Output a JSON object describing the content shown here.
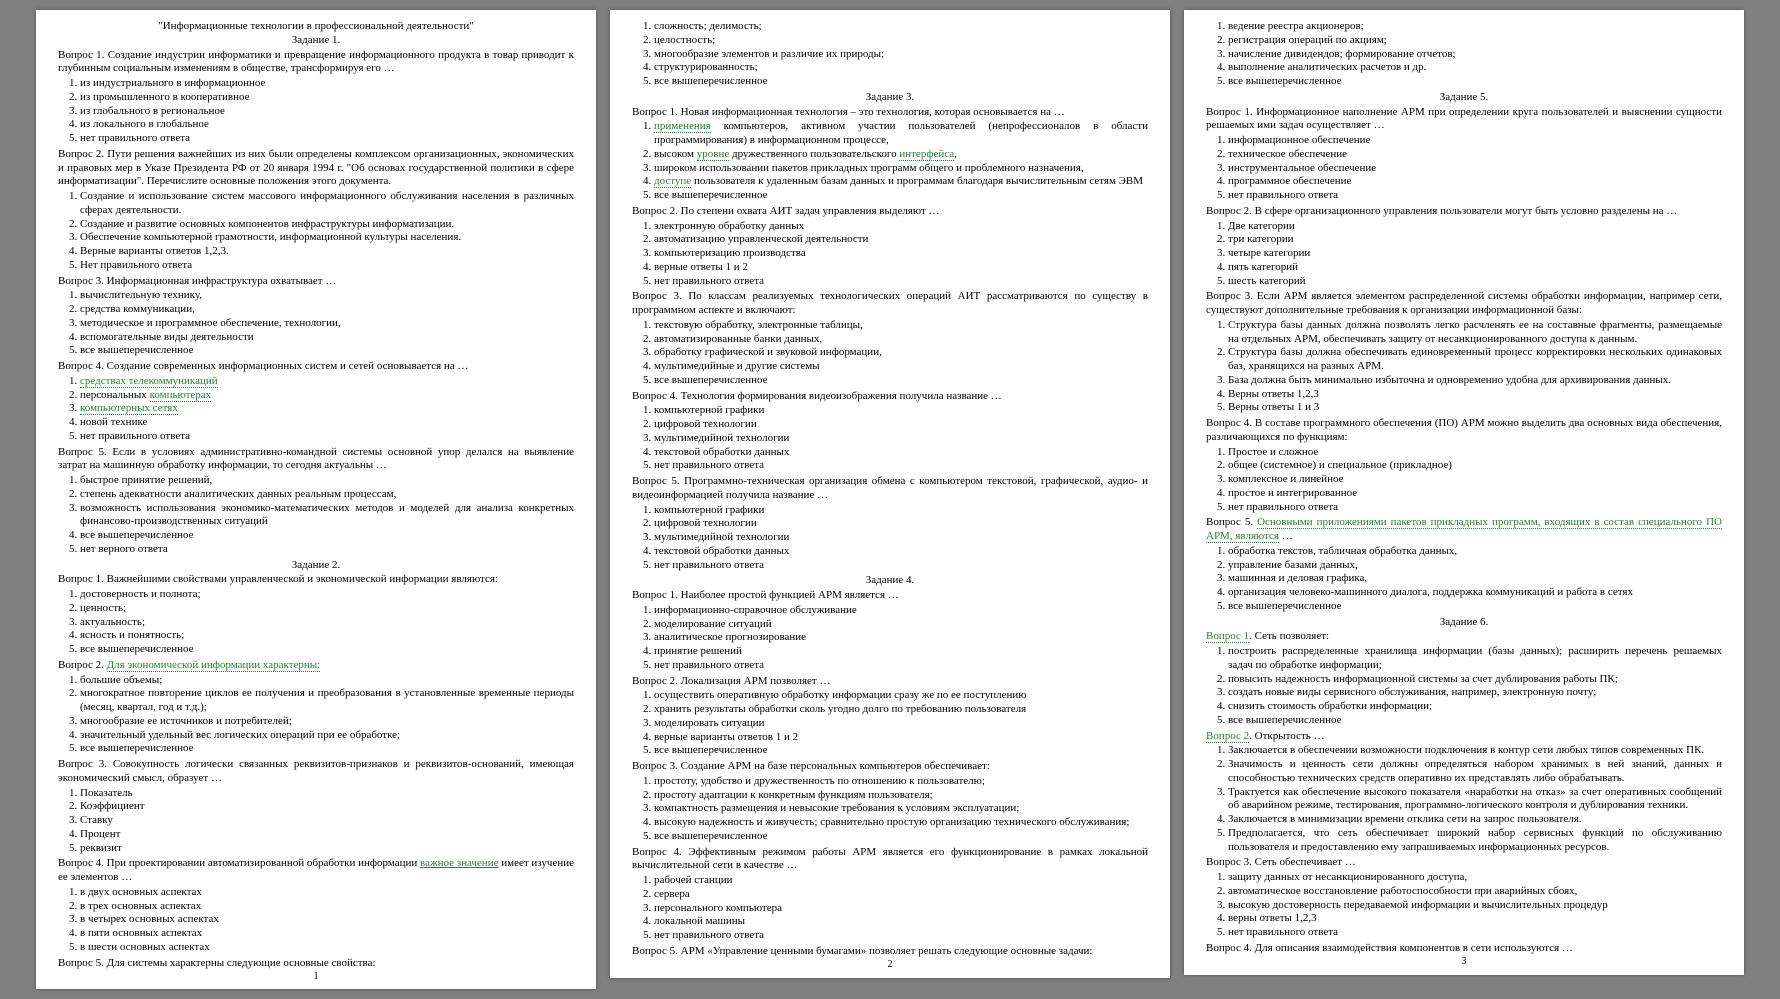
{
  "pages": [
    {
      "pagenum": "1",
      "blocks": [
        {
          "type": "title",
          "text": "\"Информационные технологии в профессиональной деятельности\""
        },
        {
          "type": "title",
          "text": "Задание 1."
        },
        {
          "type": "para",
          "text": "Вопрос 1. Создание индустрии информатики и превращение информационного продукта в товар приводит к глубинным социальным изменениям в обществе, трансформируя его …"
        },
        {
          "type": "list",
          "items": [
            "из индустриального в информационное",
            "из промышленного в кооперативное",
            "из глобального в региональное",
            "из локального в глобальное",
            "нет правильного ответа"
          ]
        },
        {
          "type": "para",
          "text": "Вопрос 2.  Пути решения важнейших из них были определены комплексом организационных, экономических и правовых мер в Указе Президента РФ от 20 января 1994 г. \"Об основах государственной политики в сфере информатизации\". Перечислите основные положения этого документа."
        },
        {
          "type": "list",
          "items": [
            "Создание и использование систем массового информационного обслуживания населения в различных сферах деятельности.",
            "Создание и развитие основных компонентов инфраструктуры   информатизации.",
            "Обеспечение компьютерной грамотности, информационной   культуры населения.",
            "Верные варианты ответов 1,2,3.",
            "Нет правильного ответа"
          ]
        },
        {
          "type": "para",
          "text": "Вопрос 3. Информационная инфраструктура охватывает …"
        },
        {
          "type": "list",
          "items": [
            "вычислительную технику,",
            "средства коммуникации,",
            "методическое и программное обеспечение,  технологии,",
            "вспомогательные виды деятельности",
            "все вышеперечисленное"
          ]
        },
        {
          "type": "para",
          "text": "Вопрос 4. Создание современных информационных систем и сетей основывается на …"
        },
        {
          "type": "list",
          "items": [
            {
              "type": "styled",
              "style": "green-dotted",
              "text": "средствах телекоммуникаций"
            },
            {
              "type": "mixed",
              "parts": [
                {
                  "text": "персональных "
                },
                {
                  "style": "green-dotted",
                  "text": "компьютерах"
                }
              ]
            },
            {
              "type": "styled",
              "style": "green-dotted",
              "text": "компьютерных сетях"
            },
            "новой технике",
            "нет правильного ответа"
          ]
        },
        {
          "type": "para",
          "text": "Вопрос 5. Если в   условиях административно-командной системы основной упор делался на выявление затрат на машинную обработку информации,  то сегодня актуальны …"
        },
        {
          "type": "list",
          "items": [
            "быстрое принятие решений,",
            "степень адекватности аналитических данных реальным процессам,",
            "возможность использования экономико-математических методов и моделей для анализа конкретных финансово-производственных ситуаций",
            "все вышеперечисленное",
            "нет верного ответа"
          ]
        },
        {
          "type": "title",
          "text": "Задание 2."
        },
        {
          "type": "para",
          "text": "Вопрос 1. Важнейшими свойствами управленческой и экономической информации являются:"
        },
        {
          "type": "list",
          "items": [
            "достоверность и полнота;",
            "ценность;",
            "актуальность;",
            "ясность и понятность;",
            "все вышеперечисленное"
          ]
        },
        {
          "type": "mixed-para",
          "parts": [
            {
              "text": "Вопрос 2. "
            },
            {
              "style": "green-dotted",
              "text": "Для экономической информации характерны:"
            }
          ]
        },
        {
          "type": "list",
          "items": [
            "большие объемы;",
            "многократное повторение циклов ее получения и преобразования в установленные временные периоды (месяц, квартал, год и т.д.);",
            "многообразие ее источников и потребителей;",
            "значительный удельный вес логических операций при ее обработке;",
            "все вышеперечисленное"
          ]
        },
        {
          "type": "para",
          "text": "Вопрос 3. Совокупность логически связанных реквизитов-признаков и  реквизитов-оснований, имеющая экономический смысл, образует …"
        },
        {
          "type": "list",
          "items": [
            "Показатель",
            "Коэффициент",
            "Ставку",
            "Процент",
            "реквизит"
          ]
        },
        {
          "type": "mixed-para",
          "parts": [
            {
              "text": "Вопрос 4. При проектировании автоматизированной обработки информации "
            },
            {
              "style": "green-solid",
              "text": "важное значение"
            },
            {
              "text": " имеет изучение ее элементов …"
            }
          ]
        },
        {
          "type": "list",
          "items": [
            "в двух основных аспектах",
            "в трех основных аспектах",
            "в четырех основных аспектах",
            "в пяти основных аспектах",
            "в шести основных аспектах"
          ]
        },
        {
          "type": "para",
          "text": "Вопрос 5. Для системы характерны следующие основные свойства:"
        }
      ]
    },
    {
      "pagenum": "2",
      "blocks": [
        {
          "type": "list",
          "items": [
            "сложность; делимость;",
            "целостность;",
            "многообразие элементов и различие их природы;",
            "структурированность;",
            "все вышеперечисленное"
          ]
        },
        {
          "type": "title",
          "text": "Задание 3."
        },
        {
          "type": "para",
          "text": "Вопрос 1. Новая информационная технология – это технология, которая основывается на …"
        },
        {
          "type": "list",
          "items": [
            {
              "type": "mixed",
              "parts": [
                {
                  "style": "green-dotted",
                  "text": "применения"
                },
                {
                  "text": " компьютеров,  активном участии пользователей (непрофессионалов в области программирования)   в информационном процессе,"
                }
              ]
            },
            {
              "type": "mixed",
              "parts": [
                {
                  "text": "высоком "
                },
                {
                  "style": "green-dotted",
                  "text": "уровне"
                },
                {
                  "text": " дружественного пользовательского "
                },
                {
                  "style": "green-dotted",
                  "text": "интерфейса"
                },
                {
                  "text": ","
                }
              ]
            },
            "широком использовании пакетов прикладных программ общего и проблемного назначения,",
            {
              "type": "mixed",
              "parts": [
                {
                  "style": "green-dotted",
                  "text": "доступе"
                },
                {
                  "text": " пользователя к удаленным базам данных и программам   благодаря вычислительным сетям ЭВМ"
                }
              ]
            },
            "все вышеперечисленное"
          ]
        },
        {
          "type": "para",
          "text": "Вопрос 2. По степени охвата АИТ задач управления выделяют …"
        },
        {
          "type": "list",
          "items": [
            "электронную обработку данных",
            "автоматизацию управленческой деятельности",
            "компьютеризацию производства",
            "верные ответы 1 и 2",
            "нет правильного ответа"
          ]
        },
        {
          "type": "para",
          "text": "Вопрос 3. По классам реализуемых технологических операций АИТ рассматриваются по существу в программном аспекте и включают:"
        },
        {
          "type": "list",
          "items": [
            "текстовую обработку, электронные таблицы,",
            "автоматизированные банки данных,",
            "обработку графической и звуковой информации,",
            "мультимедийные и другие системы",
            "все вышеперечисленное"
          ]
        },
        {
          "type": "para",
          "text": "Вопрос 4. Технология формирования видеоизображения получила название …"
        },
        {
          "type": "list",
          "items": [
            "компьютерной графики",
            "цифровой технологии",
            "мультимедийной технологии",
            "текстовой обработки данных",
            "нет правильного ответа"
          ]
        },
        {
          "type": "para",
          "text": "Вопрос 5. Программно-техническая организация обмена с компьютером текстовой, графической, аудио- и видеоинформацией получила название …"
        },
        {
          "type": "list",
          "items": [
            "компьютерной графики",
            "цифровой технологии",
            "мультимедийной технологии",
            "текстовой обработки данных",
            "нет правильного ответа"
          ]
        },
        {
          "type": "title",
          "text": "Задание 4."
        },
        {
          "type": "para",
          "text": "Вопрос 1. Наиболее простой функцией АРМ является …"
        },
        {
          "type": "list",
          "items": [
            "информационно-справочное обслуживание",
            "моделирование ситуаций",
            "аналитическое прогнозирование",
            "принятие решений",
            "нет правильного ответа"
          ]
        },
        {
          "type": "para",
          "text": "Вопрос 2. Локализация АРМ позволяет …"
        },
        {
          "type": "list",
          "items": [
            "осуществить оперативную обработку информации сразу же по ее поступлению",
            "хранить результаты обработки сколь угодно долго по требованию пользователя",
            "моделировать ситуации",
            "верные варианты ответов 1 и 2",
            "все вышеперечисленное"
          ]
        },
        {
          "type": "para",
          "text": "Вопрос 3. Создание АРМ на базе персональных компьютеров обеспечивает:"
        },
        {
          "type": "list",
          "items": [
            "простоту, удобство и дружественность по отношению к пользователю;",
            "простоту адаптации к конкретным функциям пользователя;",
            "компактность размещения и невысокие требования к условиям эксплуатации;",
            "высокую надежность и живучесть; сравнительно простую организацию технического обслуживания;",
            "все вышеперечисленное"
          ]
        },
        {
          "type": "para",
          "text": "Вопрос 4. Эффективным режимом работы АРМ является его функционирование в рамках локальной вычислительной сети в качестве …"
        },
        {
          "type": "list",
          "items": [
            "рабочей станции",
            "сервера",
            "персонального компьютера",
            "локальной машины",
            "нет правильного ответа"
          ]
        },
        {
          "type": "para",
          "text": "Вопрос 5. АРМ «Управление ценными бумагами»  позволяет решать   следующие основные задачи:"
        }
      ]
    },
    {
      "pagenum": "3",
      "blocks": [
        {
          "type": "list",
          "items": [
            "ведение реестра акционеров;",
            "регистрация операций по акциям;",
            "начисление дивидендов; формирование отчетов;",
            "выполнение аналитических расчетов и др.",
            "все вышеперечисленное"
          ]
        },
        {
          "type": "title",
          "text": "Задание 5."
        },
        {
          "type": "para",
          "text": "Вопрос 1. Информационное наполнение АРМ при определении круга пользователей и выяснении сущности решаемых ими задач осуществляет …"
        },
        {
          "type": "list",
          "items": [
            "информационное обеспечение",
            "техническое обеспечение",
            "инструментальное обеспечение",
            "программное обеспечение",
            "нет правильного ответа"
          ]
        },
        {
          "type": "para",
          "text": "Вопрос 2.  В сфере организационного управления пользователи могут быть условно разделены на …"
        },
        {
          "type": "list",
          "items": [
            "Две категории",
            "три категории",
            "четыре категории",
            "пять категорий",
            "шесть категорий"
          ]
        },
        {
          "type": "para",
          "text": "Вопрос 3. Если АРМ является элементом распределенной системы обработки информации, например сети, существуют дополнительные требования к организации информационной базы:"
        },
        {
          "type": "list",
          "items": [
            "Структура базы данных должна позволять легко расчленять ее на составные фрагменты, размещаемые на отдельных АРМ, обеспечивать защиту от несанкционированного  доступа к данным.",
            "Структура базы должна обеспечивать единовременный процесс корректировки нескольких одинаковых баз,  хранящихся  на разных АРМ.",
            "База должна быть минимально избыточна и одновременно   удобна для архивирования данных.",
            "Верны ответы 1,2,3",
            "Верны ответы 1 и 3"
          ]
        },
        {
          "type": "para",
          "text": "Вопрос 4. В составе программного обеспечения (ПО) АРМ можно выделить два основных вида обеспечения, различающихся по функциям:"
        },
        {
          "type": "list",
          "items": [
            "Простое и сложное",
            "общее (системное) и  специальное   (прикладное)",
            "комплексное и линейное",
            "простое и интегрированное",
            "нет правильного ответа"
          ]
        },
        {
          "type": "mixed-para",
          "parts": [
            {
              "text": "Вопрос 5. "
            },
            {
              "style": "green-dotted",
              "text": "Основными приложениями пакетов прикладных программ, входящих в состав специального ПО АРМ, являются"
            },
            {
              "text": " …"
            }
          ]
        },
        {
          "type": "list",
          "items": [
            "обработка текстов, табличная обработка данных,",
            "управление базами данных,",
            "машинная и деловая графика,",
            "организация человеко-машинного диалога, поддержка коммуникаций и работа в сетях",
            "все вышеперечисленное"
          ]
        },
        {
          "type": "title",
          "text": "Задание 6."
        },
        {
          "type": "mixed-para",
          "parts": [
            {
              "style": "green-dotted",
              "text": "Вопрос 1"
            },
            {
              "text": ". Сеть позволяет:"
            }
          ]
        },
        {
          "type": "list",
          "items": [
            "построить распределенные хранилища информации (базы   данных); расширить перечень решаемых задач по обработке информации;",
            "повысить надежность информационной системы за счет дублирования работы ПК;",
            "создать новые виды сервисного обслуживания,  например,  электронную почту;",
            "снизить стоимость обработки информации;",
            "все вышеперечисленное"
          ]
        },
        {
          "type": "mixed-para",
          "parts": [
            {
              "style": "green-dotted",
              "text": "Вопрос 2"
            },
            {
              "text": ". Открытость …"
            }
          ]
        },
        {
          "type": "list",
          "items": [
            "Заключается в обеспечении возможности подключения в контур сети любых типов современных ПК.",
            "Значимость и ценность сети должны определяться набором хранимых в ней знаний, данных и способностью технических средств оперативно их представлять либо обрабатывать.",
            "Трактуется как обеспечение высокого показателя «наработки на отказ» за счет оперативных сообщений об аварийном режиме,  тестирования, программно-логического контроля и дублирования техники.",
            "Заключается в минимизации времени отклика сети на запрос пользователя.",
            "Предполагается, что сеть обеспечивает широкий набор сервисных функций по обслуживанию пользователя и предоставлению ему запрашиваемых информационных ресурсов."
          ]
        },
        {
          "type": "para",
          "text": "Вопрос 3. Сеть обеспечивает …"
        },
        {
          "type": "list",
          "items": [
            "защиту данных от несанкционированного доступа,",
            "автоматическое восстановление работоспособности при аварийных сбоях,",
            "высокую достоверность передаваемой информации и вычислительных процедур",
            "верны ответы 1,2,3",
            "нет правильного ответа"
          ]
        },
        {
          "type": "para",
          "text": "Вопрос 4. Для описания взаимодействия компонентов в сети используются …"
        }
      ]
    }
  ]
}
